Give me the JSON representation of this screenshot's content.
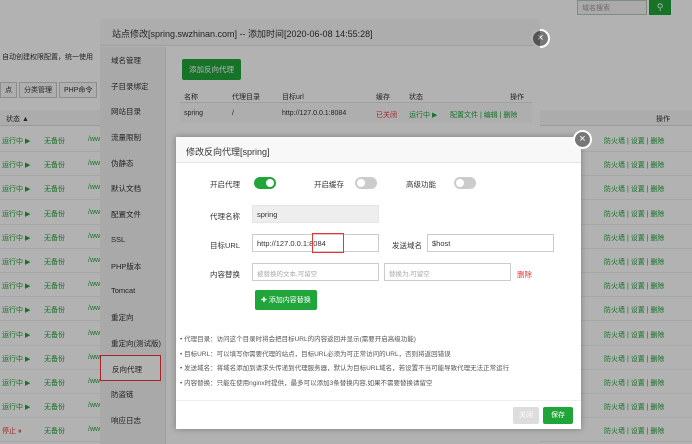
{
  "bg": {
    "search_placeholder": "域名搜索",
    "search_icon": "search-icon",
    "notice": "自动创建权限配置，统一使用",
    "toolbar": [
      "点",
      "分类管理",
      "PHP命令"
    ],
    "col_status": "状态 ▲",
    "col_actions": "操作",
    "rows": [
      {
        "status": "运行中 ▶",
        "backup": "无备份",
        "path": "/ww",
        "actions": "防火墙 | 设置 | 删除"
      },
      {
        "status": "运行中 ▶",
        "backup": "无备份",
        "path": "/ww",
        "actions": "防火墙 | 设置 | 删除"
      },
      {
        "status": "运行中 ▶",
        "backup": "无备份",
        "path": "/ww",
        "actions": "防火墙 | 设置 | 删除"
      },
      {
        "status": "运行中 ▶",
        "backup": "无备份",
        "path": "/ww",
        "actions": "防火墙 | 设置 | 删除"
      },
      {
        "status": "运行中 ▶",
        "backup": "无备份",
        "path": "/ww",
        "actions": "防火墙 | 设置 | 删除"
      },
      {
        "status": "运行中 ▶",
        "backup": "无备份",
        "path": "/ww",
        "actions": "防火墙 | 设置 | 删除"
      },
      {
        "status": "运行中 ▶",
        "backup": "无备份",
        "path": "/ww",
        "actions": "防火墙 | 设置 | 删除"
      },
      {
        "status": "运行中 ▶",
        "backup": "无备份",
        "path": "/ww",
        "actions": "防火墙 | 设置 | 删除"
      },
      {
        "status": "运行中 ▶",
        "backup": "无备份",
        "path": "/ww",
        "actions": "防火墙 | 设置 | 删除"
      },
      {
        "status": "运行中 ▶",
        "backup": "无备份",
        "path": "/ww",
        "actions": "防火墙 | 设置 | 删除"
      },
      {
        "status": "运行中 ▶",
        "backup": "无备份",
        "path": "/ww",
        "actions": "防火墙 | 设置 | 删除"
      },
      {
        "status": "运行中 ▶",
        "backup": "无备份",
        "path": "/ww",
        "actions": "防火墙 | 设置 | 删除"
      },
      {
        "status": "停止 ⏸",
        "backup": "无备份",
        "path": "/www/wwwroot/www.fishenup.com",
        "actions": "防火墙 | 设置 | 删除"
      }
    ]
  },
  "outer": {
    "title": "站点修改[spring.swzhinan.com] -- 添加时间[2020-06-08 14:55:28]",
    "menu": [
      "域名管理",
      "子目录绑定",
      "网站目录",
      "流量限制",
      "伪静态",
      "默认文档",
      "配置文件",
      "SSL",
      "PHP版本",
      "Tomcat",
      "重定向",
      "重定向(测试版)",
      "反向代理",
      "防盗链",
      "响应日志"
    ],
    "active_menu_index": 12,
    "add_button": "添加反向代理",
    "table_headers": [
      "名称",
      "代理目录",
      "目标url",
      "缓存",
      "状态",
      "操作"
    ],
    "table_row": {
      "name": "spring",
      "dir": "/",
      "url": "http://127.0.0.1:8084",
      "cache": "已关闭",
      "status": "运行中 ▶",
      "ops": "配置文件 | 编辑 | 删除"
    }
  },
  "inner": {
    "title": "修改反向代理[spring]",
    "enable_proxy_label": "开启代理",
    "enable_proxy": true,
    "enable_cache_label": "开启缓存",
    "enable_cache": false,
    "advanced_label": "高级功能",
    "advanced": false,
    "proxy_name_label": "代理名称",
    "proxy_name": "spring",
    "target_url_label": "目标URL",
    "target_url": "http://127.0.0.1:8084",
    "send_domain_label": "发送域名",
    "send_domain": "$host",
    "content_replace_label": "内容替换",
    "replace_from_placeholder": "被替换的文本,可留空",
    "replace_to_placeholder": "替换为,可留空",
    "delete_label": "删除",
    "add_content_button": "添加内容替换",
    "tips": [
      "代理目录：访问这个目录时将会把目标URL的内容返回并显示(需要开启高级功能)",
      "目标URL：可以填写你需要代理的站点，目标URL必须为可正常访问的URL，否则将返回错误",
      "发送域名：将域名添加到请求头传递到代理服务器，默认为目标URL域名，若设置不当可能导致代理无法正常运行",
      "内容替换：只能在使用nginx时提供，最多可以添加3条替换内容,如果不需要替换请留空"
    ],
    "close_button": "关闭",
    "save_button": "保存"
  }
}
